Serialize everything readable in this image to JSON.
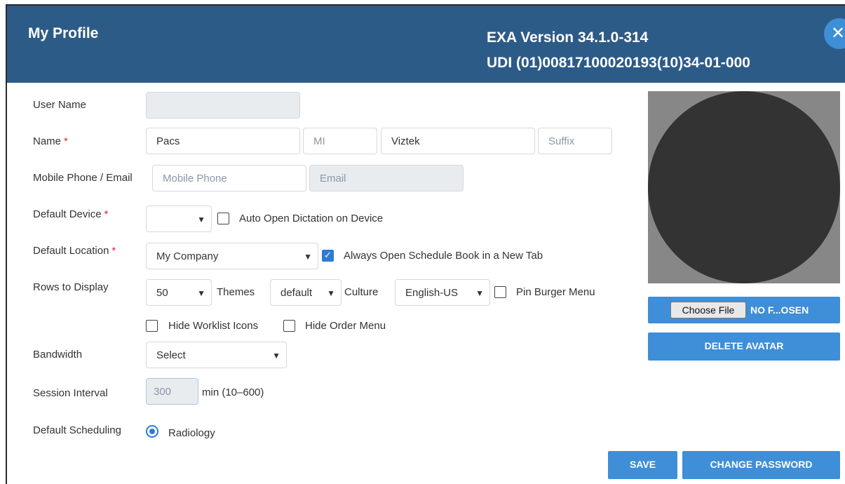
{
  "header": {
    "title": "My Profile",
    "version": "EXA Version 34.1.0-314",
    "udi": "UDI (01)00817100020193(10)34-01-000",
    "close_icon": "close-icon"
  },
  "form": {
    "user_name": {
      "label": "User Name",
      "value": ""
    },
    "name": {
      "label": "Name",
      "required_mark": "*",
      "first": "Pacs",
      "mi_placeholder": "MI",
      "last": "Viztek",
      "suffix_placeholder": "Suffix"
    },
    "contact": {
      "label": "Mobile Phone / Email",
      "phone_placeholder": "Mobile Phone",
      "email_placeholder": "Email"
    },
    "default_device": {
      "label": "Default Device",
      "required_mark": "*",
      "value": "",
      "auto_open_label": "Auto Open Dictation on Device",
      "auto_open_checked": false
    },
    "default_location": {
      "label": "Default Location",
      "required_mark": "*",
      "value": "My Company",
      "schedule_label": "Always Open Schedule Book in a New Tab",
      "schedule_checked": true
    },
    "rows": {
      "label": "Rows to Display",
      "value": "50",
      "themes_label": "Themes",
      "themes_value": "default",
      "culture_label": "Culture",
      "culture_value": "English-US",
      "pin_label": "Pin Burger Menu",
      "pin_checked": false
    },
    "hide": {
      "worklist_icons_label": "Hide Worklist Icons",
      "worklist_icons_checked": false,
      "order_menu_label": "Hide Order Menu",
      "order_menu_checked": false
    },
    "bandwidth": {
      "label": "Bandwidth",
      "value": "Select"
    },
    "session": {
      "label": "Session Interval",
      "value": "300",
      "unit": "min (10–600)"
    },
    "scheduling": {
      "label": "Default Scheduling",
      "option": "Radiology",
      "selected": true
    }
  },
  "avatar": {
    "choose_file_label": "Choose File",
    "file_status": "NO F...OSEN",
    "delete_label": "DELETE AVATAR"
  },
  "actions": {
    "save_label": "SAVE",
    "change_password_label": "CHANGE PASSWORD"
  },
  "colors": {
    "header_bg": "#2d5b88",
    "button_bg": "#3e8ed8",
    "required": "#d9282f",
    "checkbox_checked": "#2d7bd6"
  }
}
